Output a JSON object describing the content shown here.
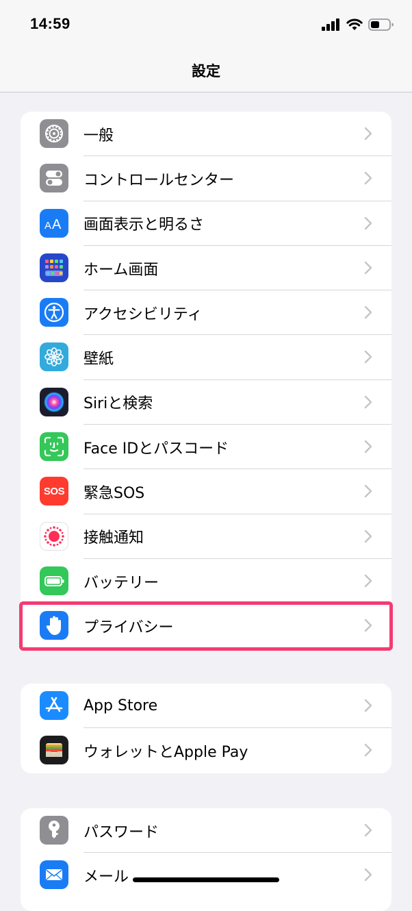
{
  "status_bar": {
    "time": "14:59"
  },
  "nav": {
    "title": "設定"
  },
  "groups": [
    {
      "items": [
        {
          "id": "general",
          "label": "一般",
          "icon": "gear-icon",
          "color": "#8e8e93"
        },
        {
          "id": "control-center",
          "label": "コントロールセンター",
          "icon": "toggles-icon",
          "color": "#8e8e93"
        },
        {
          "id": "display-brightness",
          "label": "画面表示と明るさ",
          "icon": "text-size-icon",
          "color": "#1a7cf5"
        },
        {
          "id": "home-screen",
          "label": "ホーム画面",
          "icon": "home-grid-icon",
          "color": "#2747c9"
        },
        {
          "id": "accessibility",
          "label": "アクセシビリティ",
          "icon": "accessibility-icon",
          "color": "#1a7cf5"
        },
        {
          "id": "wallpaper",
          "label": "壁紙",
          "icon": "flower-icon",
          "color": "#33aadc"
        },
        {
          "id": "siri-search",
          "label": "Siriと検索",
          "icon": "siri-icon",
          "color": "#1c1c2e"
        },
        {
          "id": "face-id",
          "label": "Face IDとパスコード",
          "icon": "face-id-icon",
          "color": "#34c759"
        },
        {
          "id": "emergency-sos",
          "label": "緊急SOS",
          "icon": "sos-icon",
          "color": "#ff3b30"
        },
        {
          "id": "exposure",
          "label": "接触通知",
          "icon": "exposure-icon",
          "color": "#ffffff"
        },
        {
          "id": "battery",
          "label": "バッテリー",
          "icon": "battery-icon",
          "color": "#34c759"
        },
        {
          "id": "privacy",
          "label": "プライバシー",
          "icon": "hand-icon",
          "color": "#1a7cf5"
        }
      ]
    },
    {
      "items": [
        {
          "id": "app-store",
          "label": "App Store",
          "icon": "app-store-icon",
          "color": "#1a8cff"
        },
        {
          "id": "wallet",
          "label": "ウォレットとApple Pay",
          "icon": "wallet-icon",
          "color": "#1c1c1e"
        }
      ]
    },
    {
      "items": [
        {
          "id": "passwords",
          "label": "パスワード",
          "icon": "key-icon",
          "color": "#8e8e93"
        },
        {
          "id": "mail",
          "label": "メール",
          "icon": "mail-icon",
          "color": "#1a7cf5"
        }
      ]
    }
  ],
  "highlight_color": "#f43b72"
}
